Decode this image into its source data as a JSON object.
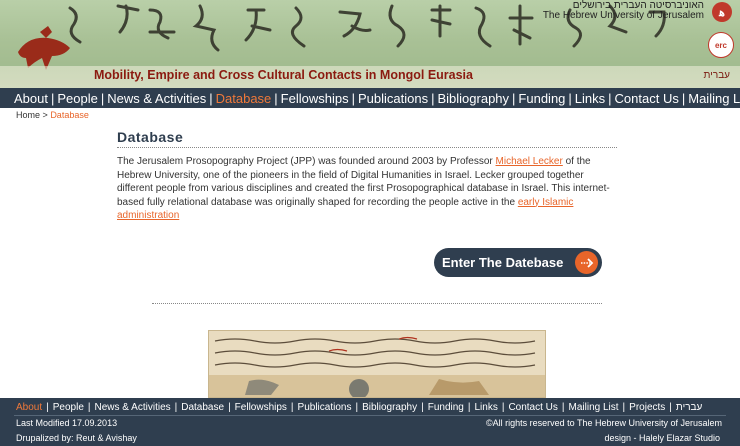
{
  "header": {
    "site_title": "Mobility, Empire and Cross Cultural Contacts in Mongol Eurasia",
    "hebrew_link": "עברית",
    "university_hebrew": "האוניברסיטה העברית בירושלים",
    "university_english": "The Hebrew University of Jerusalem",
    "erc_label": "erc"
  },
  "nav": {
    "items": [
      {
        "label": "About"
      },
      {
        "label": "People"
      },
      {
        "label": "News & Activities"
      },
      {
        "label": "Database"
      },
      {
        "label": "Fellowships"
      },
      {
        "label": "Publications"
      },
      {
        "label": "Bibliography"
      },
      {
        "label": "Funding"
      },
      {
        "label": "Links"
      },
      {
        "label": "Contact Us"
      },
      {
        "label": "Mailing List"
      }
    ],
    "active": "Database"
  },
  "breadcrumb": {
    "home": "Home",
    "separator": ">",
    "current": "Database"
  },
  "content": {
    "title": "Database",
    "p1_a": "The Jerusalem Prosopography Project (JPP) was founded around 2003 by Professor ",
    "p1_link1": "Michael Lecker",
    "p1_b": " of the Hebrew University, one of the pioneers in the field of Digital Humanities in Israel. Lecker grouped together different people from various disciplines and created the first Prosopographical database in Israel. This internet-based fully relational database was originally shaped for recording the people active in the ",
    "p1_link2": "early Islamic administration",
    "enter_button": "Enter The Datebase"
  },
  "footer": {
    "nav": [
      {
        "label": "About"
      },
      {
        "label": "People"
      },
      {
        "label": "News & Activities"
      },
      {
        "label": "Database"
      },
      {
        "label": "Fellowships"
      },
      {
        "label": "Publications"
      },
      {
        "label": "Bibliography"
      },
      {
        "label": "Funding"
      },
      {
        "label": "Links"
      },
      {
        "label": "Contact Us"
      },
      {
        "label": "Mailing List"
      },
      {
        "label": "Projects"
      },
      {
        "label": "עברית"
      }
    ],
    "active": "About",
    "last_modified": "Last Modified 17.09.2013",
    "copyright": "©All rights reserved to The Hebrew University of Jerusalem",
    "drupalized": "Drupalized by: Reut & Avishay",
    "design": "design - Halely Elazar Studio"
  },
  "colors": {
    "nav_bg": "#2f3e4f",
    "accent": "#e8652a",
    "title_red": "#8b1a10"
  }
}
